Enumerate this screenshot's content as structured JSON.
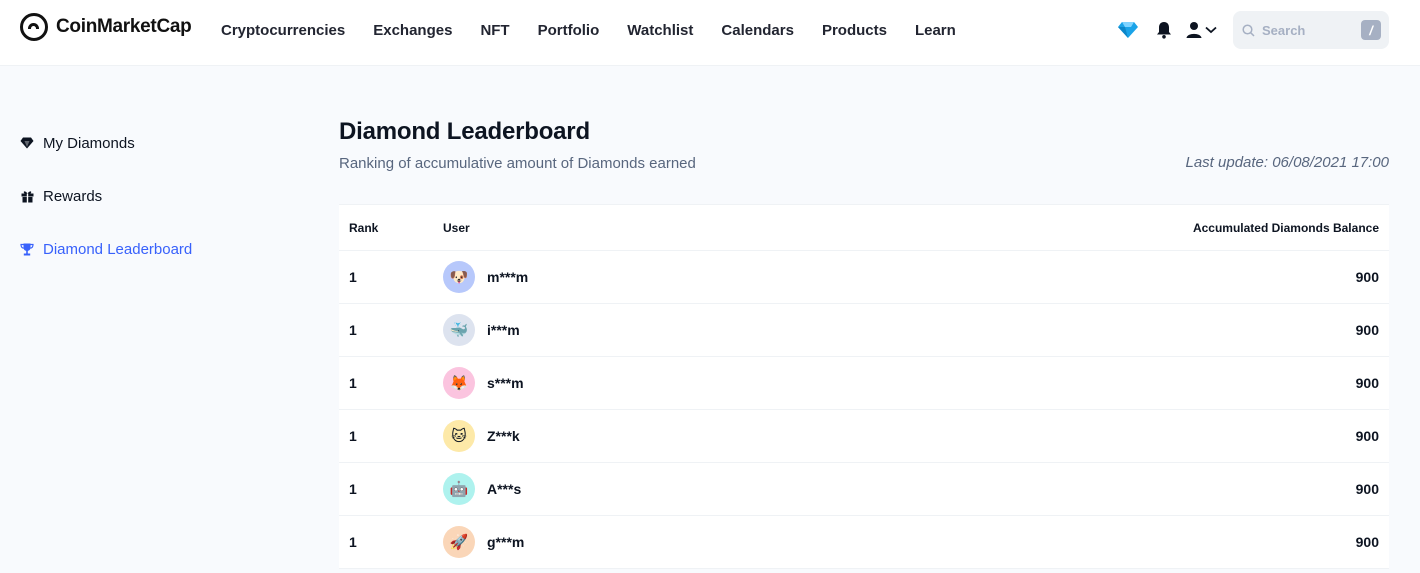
{
  "header": {
    "brand": "CoinMarketCap",
    "nav": [
      "Cryptocurrencies",
      "Exchanges",
      "NFT",
      "Portfolio",
      "Watchlist",
      "Calendars",
      "Products",
      "Learn"
    ],
    "search_placeholder": "Search",
    "search_shortcut": "/",
    "icons": [
      "diamond-icon",
      "bell-icon",
      "user-icon",
      "chevron-down-icon",
      "search-icon"
    ]
  },
  "sidebar": {
    "items": [
      {
        "label": "My Diamonds",
        "icon": "diamond-icon"
      },
      {
        "label": "Rewards",
        "icon": "gift-icon"
      },
      {
        "label": "Diamond Leaderboard",
        "icon": "trophy-icon",
        "active": true
      }
    ]
  },
  "main": {
    "title": "Diamond Leaderboard",
    "subtitle": "Ranking of accumulative amount of Diamonds earned",
    "last_update": "Last update: 06/08/2021 17:00",
    "table": {
      "headers": {
        "rank": "Rank",
        "user": "User",
        "balance": "Accumulated Diamonds Balance"
      },
      "rows": [
        {
          "rank": "1",
          "user": "m***m",
          "balance": "900",
          "avatar": "🐶",
          "avatar_bg": "#b7c8fb"
        },
        {
          "rank": "1",
          "user": "i***m",
          "balance": "900",
          "avatar": "🐳",
          "avatar_bg": "#dde3ef"
        },
        {
          "rank": "1",
          "user": "s***m",
          "balance": "900",
          "avatar": "🦊",
          "avatar_bg": "#fbc4df"
        },
        {
          "rank": "1",
          "user": "Z***k",
          "balance": "900",
          "avatar": "🐱",
          "avatar_bg": "#fde9a8"
        },
        {
          "rank": "1",
          "user": "A***s",
          "balance": "900",
          "avatar": "🤖",
          "avatar_bg": "#aef2ee"
        },
        {
          "rank": "1",
          "user": "g***m",
          "balance": "900",
          "avatar": "🚀",
          "avatar_bg": "#fad6b8"
        }
      ]
    }
  },
  "colors": {
    "accent": "#3861fb",
    "text": "#0d1421",
    "muted": "#58667e",
    "bg": "#f8fafd"
  }
}
